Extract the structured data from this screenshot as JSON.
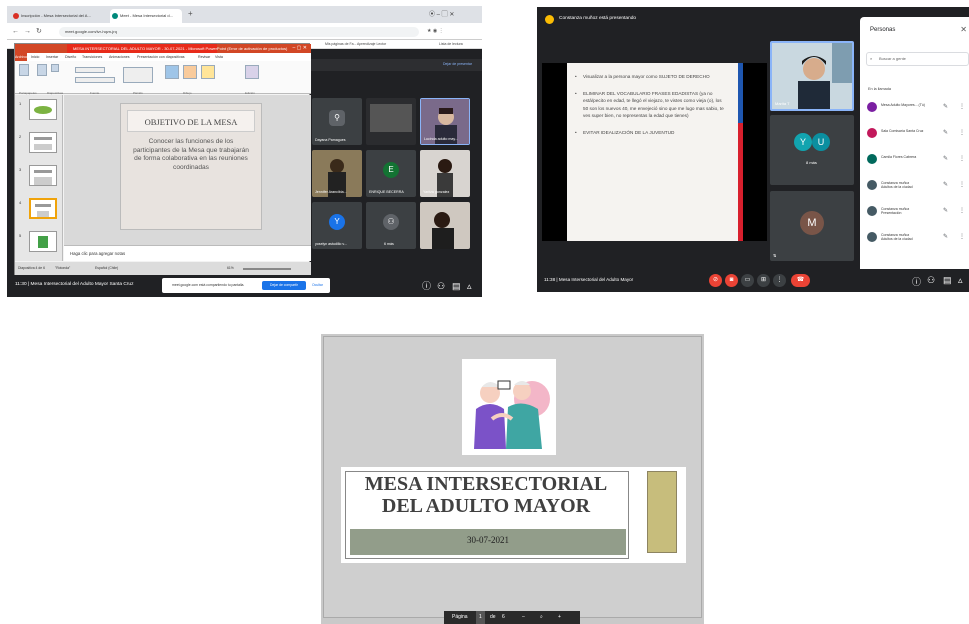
{
  "screen1": {
    "browser": {
      "tabs": [
        "Inscripción - Mesa Intersectorial del A...",
        "Meet - Mesa Intersectorial d..."
      ],
      "url": "meet.google.com/ivr-hqvn-jrq",
      "bookmarks": [
        "Mis páginas de Fa...",
        "Aprendizaje Lector",
        "Lista de lectura"
      ]
    },
    "powerpoint": {
      "title_bar": "MESA INTERSECTORIAL DEL ADULTO MAYOR - 30-07-2021 - Microsoft PowerPoint (Error de activación de productos)",
      "tabs": [
        "Archivo",
        "Inicio",
        "Insertar",
        "Diseño",
        "Transiciones",
        "Animaciones",
        "Presentación con diapositivas",
        "Revisar",
        "Vista"
      ],
      "ribbon_groups": [
        "Portapapeles",
        "Diapositivas",
        "Fuente",
        "Párrafo",
        "Dibujo",
        "Edición"
      ],
      "slide_title": "OBJETIVO DE LA MESA",
      "slide_body": "Conocer las funciones de los participantes de la Mesa que trabajarán de forma colaborativa en las reuniones coordinadas",
      "notes": "Haga clic para agregar notas",
      "status": [
        "Diapositiva 4 de 6",
        "\"Rotonda\"",
        "Español (Chile)"
      ],
      "zoom": "61%",
      "thumb_numbers": [
        "1",
        "2",
        "3",
        "4",
        "5"
      ]
    },
    "meet": {
      "top_link": "Dejar de presentar",
      "participants": [
        "Dayana Pamagues",
        "",
        "Lucinda adulto may...",
        "Jennifer Arancibia...",
        "ENRIQUE BECERRA",
        "Yaritza gonzalez",
        "yoselyn astudillo v...",
        "6 más",
        ""
      ],
      "avatar_letters": [
        "E",
        "Y"
      ],
      "meeting_info": "11:30  |  Mesa Intersectorial del Adulto Mayor Santa Cruz",
      "share_text": "meet.google.com está compartiendo tu pantalla.",
      "stop_share": "Dejar de compartir",
      "hide": "Ocultar"
    }
  },
  "screen2": {
    "presenting": "Constanza muñoz está presentando",
    "bullets": [
      "Visualizar a la persona mayor como SUJETO DE DERECHO",
      "ELIMINAR DEL VOCABULARIO FRASES EDADISTAS (ya no está/pecito en edad, te llegó el viejazo, te vistes como vieja (o), los 50 son los nuevos 40, me envejeció sino que me lugo mas sabio, te ves super bien, no representas la edad que tienes)",
      "EVITAR IDEALIZACIÓN DE LA JUVENTUD"
    ],
    "tiles": [
      "Marita T",
      "8 más",
      ""
    ],
    "tile_letters": [
      "Y",
      "U",
      "M"
    ],
    "panel_title": "Personas",
    "search_placeholder": "Buscar a gente",
    "section": "En la llamada",
    "people": [
      "Mesa Adulto Mayores... (Tú)",
      "Sala Comisaría Santa Cruz",
      "Camila Flores Cabrera",
      "Constanza muñoz\nAdultos de la ciudad",
      "Constanza muñoz\nPresentación",
      "Constanza muñoz\nAdultos de la ciudad"
    ],
    "meeting_info": "11:38  |  Mesa Intersectorial del Adulto Mayor"
  },
  "screen3": {
    "title_line1": "MESA INTERSECTORIAL",
    "title_line2": "DEL ADULTO MAYOR",
    "date": "30-07-2021",
    "pager": [
      "Página",
      "1",
      "de",
      "6"
    ]
  },
  "colors": {
    "ppt_red": "#d24726",
    "meet_dark": "#202124",
    "end_call": "#ea4335",
    "date_band": "#929d8a",
    "gold_box": "#c7bd7c"
  }
}
